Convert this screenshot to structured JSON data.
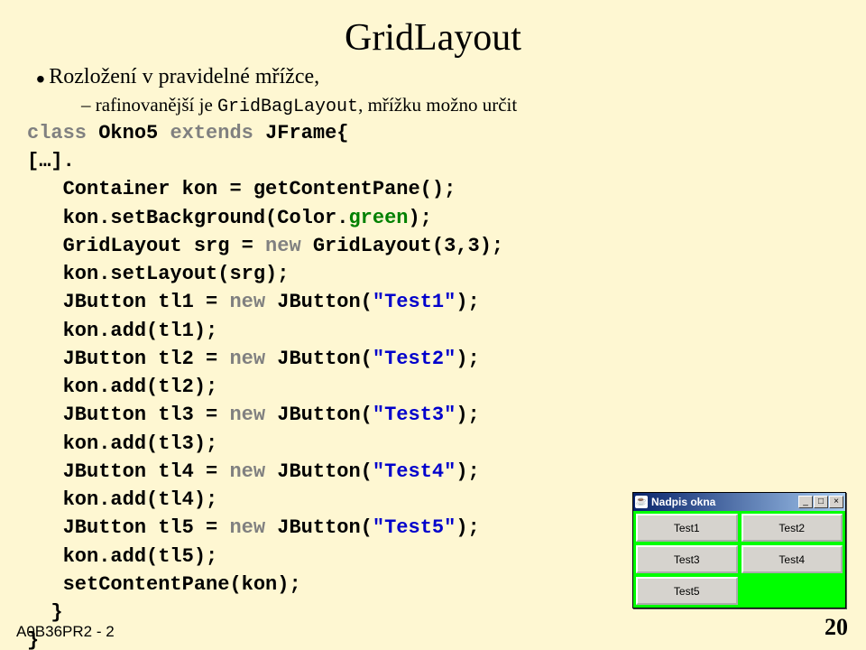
{
  "title": "GridLayout",
  "bullet": "Rozložení v pravidelné mřížce,",
  "subbullet_pre": "– rafinovanější je ",
  "subbullet_code": "GridBagLayout",
  "subbullet_post": ", mřížku možno určit",
  "code": {
    "l1a": "class ",
    "l1b": "Okno5 ",
    "l1c": "extends ",
    "l1d": "JFrame{",
    "l2": "[…].",
    "l3": "Container kon = getContentPane();",
    "l4a": "kon.setBackground(Color.",
    "l4b": "green",
    "l4c": ");",
    "l5a": "GridLayout srg = ",
    "l5b": "new ",
    "l5c": "GridLayout(3,3);",
    "l6": "kon.setLayout(srg);",
    "l7a": "JButton tl1 = ",
    "l7b": "new ",
    "l7c": "JButton(",
    "l7d": "\"Test1\"",
    "l7e": ");",
    "l8": "kon.add(tl1);",
    "l9a": "JButton tl2 = ",
    "l9b": "new ",
    "l9c": "JButton(",
    "l9d": "\"Test2\"",
    "l9e": ");",
    "l10": "kon.add(tl2);",
    "l11a": "JButton tl3 = ",
    "l11b": "new ",
    "l11c": "JButton(",
    "l11d": "\"Test3\"",
    "l11e": ");",
    "l12": "kon.add(tl3);",
    "l13a": "JButton tl4 = ",
    "l13b": "new ",
    "l13c": "JButton(",
    "l13d": "\"Test4\"",
    "l13e": ");",
    "l14": "kon.add(tl4);",
    "l15a": "JButton tl5 = ",
    "l15b": "new ",
    "l15c": "JButton(",
    "l15d": "\"Test5\"",
    "l15e": ");",
    "l16": "kon.add(tl5);",
    "l17": "setContentPane(kon);",
    "l18": "}",
    "l19": "}"
  },
  "window": {
    "title": "Nadpis okna",
    "buttons": [
      "Test1",
      "Test2",
      "Test3",
      "Test4",
      "Test5"
    ],
    "min": "_",
    "max": "□",
    "close": "×"
  },
  "footer": "A0B36PR2 - 2",
  "page": "20"
}
